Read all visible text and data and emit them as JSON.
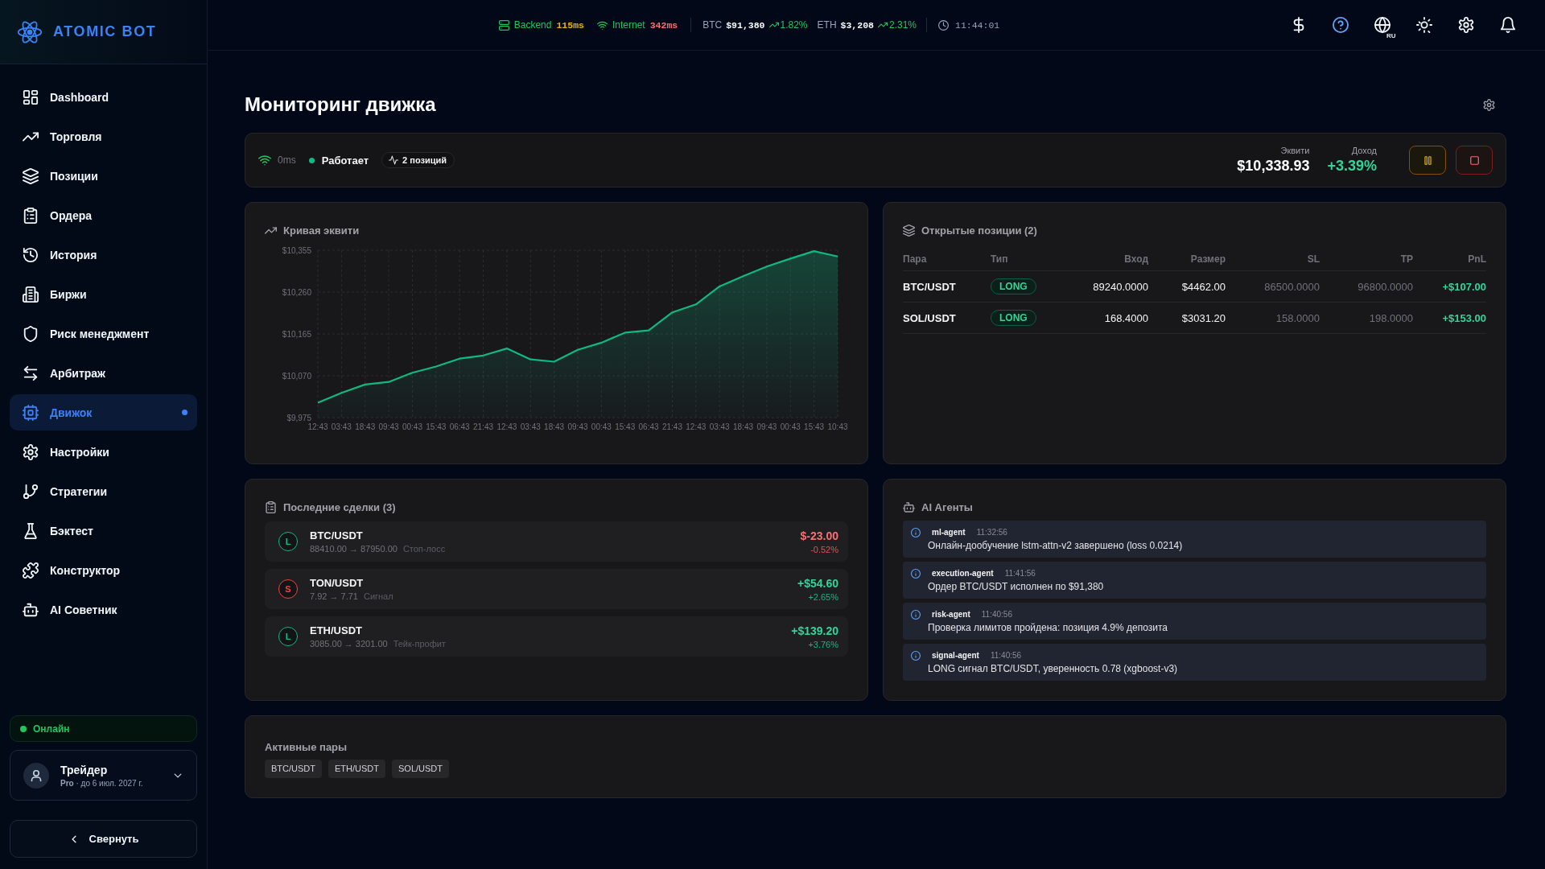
{
  "sidebar": {
    "logo": "ATOMIC BOT",
    "items": [
      {
        "label": "Dashboard",
        "selected": false,
        "dot": false
      },
      {
        "label": "Торговля",
        "selected": false,
        "dot": false
      },
      {
        "label": "Позиции",
        "selected": false,
        "dot": false
      },
      {
        "label": "Ордера",
        "selected": false,
        "dot": false
      },
      {
        "label": "История",
        "selected": false,
        "dot": false
      },
      {
        "label": "Биржи",
        "selected": false,
        "dot": false
      },
      {
        "label": "Риск менеджмент",
        "selected": false,
        "dot": false
      },
      {
        "label": "Арбитраж",
        "selected": false,
        "dot": false
      },
      {
        "label": "Движок",
        "selected": true,
        "dot": true
      },
      {
        "label": "Настройки",
        "selected": false,
        "dot": false
      },
      {
        "label": "Стратегии",
        "selected": false,
        "dot": false
      },
      {
        "label": "Бэктест",
        "selected": false,
        "dot": false
      },
      {
        "label": "Конструктор",
        "selected": false,
        "dot": false
      },
      {
        "label": "AI Советник",
        "selected": false,
        "dot": false
      }
    ],
    "status": {
      "label": "Онлайн",
      "online": true
    },
    "user": {
      "name": "Трейдер",
      "plan": "**Pro** · до 6 июл. 2027 г."
    },
    "collapse_button": "Свернуть"
  },
  "top_bar": {
    "services": [
      {
        "name": "Backend",
        "connected": true,
        "latency": "115ms",
        "color": "#eab308"
      },
      {
        "name": "Internet",
        "connected": true,
        "latency": "342ms",
        "color": "#f87171"
      }
    ],
    "tickers": [
      {
        "symbol": "BTC",
        "price": "$91,380",
        "change": "1.82%",
        "kind": "up"
      },
      {
        "symbol": "ETH",
        "price": "$3,208",
        "change": "2.31%",
        "kind": "up"
      }
    ],
    "clock": "11:44:01",
    "language": "RU"
  },
  "page": {
    "title": "Мониторинг движка"
  },
  "engine_status": {
    "latency": "0ms",
    "running": true,
    "state": "Работает",
    "positions": "2 позиций",
    "equity_label": "Эквити",
    "equity": "$10,338.93",
    "profit_label": "Доход",
    "profit": "+3.39%"
  },
  "equity_chart": {
    "chart_data": {
      "type": "area",
      "title": "Кривая эквити",
      "categories": [
        "12:43",
        "03:43",
        "18:43",
        "09:43",
        "00:43",
        "15:43",
        "06:43",
        "21:43",
        "12:43",
        "03:43",
        "18:43",
        "09:43",
        "00:43",
        "15:43",
        "06:43",
        "21:43",
        "12:43",
        "03:43",
        "18:43",
        "09:43",
        "00:43",
        "15:43",
        "10:43"
      ],
      "series": [
        {
          "color": "#10b981",
          "values": [
            10009,
            10031,
            10050,
            10056,
            10077,
            10091,
            10109,
            10116,
            10132,
            10107,
            10102,
            10129,
            10145,
            10168,
            10173,
            10214,
            10232,
            10273,
            10296,
            10318,
            10336,
            10353,
            10341
          ]
        }
      ],
      "ylim": [
        9975,
        10355
      ],
      "yticks": [
        {
          "value": 9975,
          "label": "$9,975"
        },
        {
          "value": 10070,
          "label": "$10,070"
        },
        {
          "value": 10165,
          "label": "$10,165"
        },
        {
          "value": 10260,
          "label": "$10,260"
        },
        {
          "value": 10355,
          "label": "$10,355"
        }
      ],
      "grid": true
    }
  },
  "open_positions": {
    "title": "Открытые позиции (2)",
    "columns": [
      "Пара",
      "Тип",
      "Вход",
      "Размер",
      "SL",
      "TP",
      "PnL"
    ],
    "rows": [
      {
        "pair": "BTC/USDT",
        "type": "LONG",
        "entry": "89240.0000",
        "size": "$4462.00",
        "sl": "86500.0000",
        "tp": "96800.0000",
        "pnl": "+$107.00"
      },
      {
        "pair": "SOL/USDT",
        "type": "LONG",
        "entry": "168.4000",
        "size": "$3031.20",
        "sl": "158.0000",
        "tp": "198.0000",
        "pnl": "+$153.00"
      }
    ]
  },
  "recent_trades": {
    "title": "Последние сделки (3)",
    "items": [
      {
        "side": "L",
        "color": "#10b981",
        "pair": "BTC/USDT",
        "prices": "88410.00 → 87950.00",
        "reason": "Стоп-лосс",
        "pnl": "$-23.00",
        "change": "-0.52%",
        "kind": "loss"
      },
      {
        "side": "S",
        "color": "#ef4444",
        "pair": "TON/USDT",
        "prices": "7.92 → 7.71",
        "reason": "Сигнал",
        "pnl": "+$54.60",
        "change": "+2.65%",
        "kind": "profit"
      },
      {
        "side": "L",
        "color": "#10b981",
        "pair": "ETH/USDT",
        "prices": "3085.00 → 3201.00",
        "reason": "Тейк-профит",
        "pnl": "+$139.20",
        "change": "+3.76%",
        "kind": "profit"
      }
    ]
  },
  "ai_agents": {
    "title": "AI Агенты",
    "items": [
      {
        "agent": "ml-agent",
        "time": "11:32:56",
        "message": "Онлайн-дообучение lstm-attn-v2 завершено (loss 0.0214)"
      },
      {
        "agent": "execution-agent",
        "time": "11:41:56",
        "message": "Ордер BTC/USDT исполнен по $91,380"
      },
      {
        "agent": "risk-agent",
        "time": "11:40:56",
        "message": "Проверка лимитов пройдена: позиция 4.9% депозита"
      },
      {
        "agent": "signal-agent",
        "time": "11:40:56",
        "message": "LONG сигнал BTC/USDT, уверенность 0.78 (xgboost-v3)"
      }
    ]
  },
  "active_pairs": {
    "title": "Активные пары",
    "pairs": [
      "BTC/USDT",
      "ETH/USDT",
      "SOL/USDT"
    ]
  }
}
